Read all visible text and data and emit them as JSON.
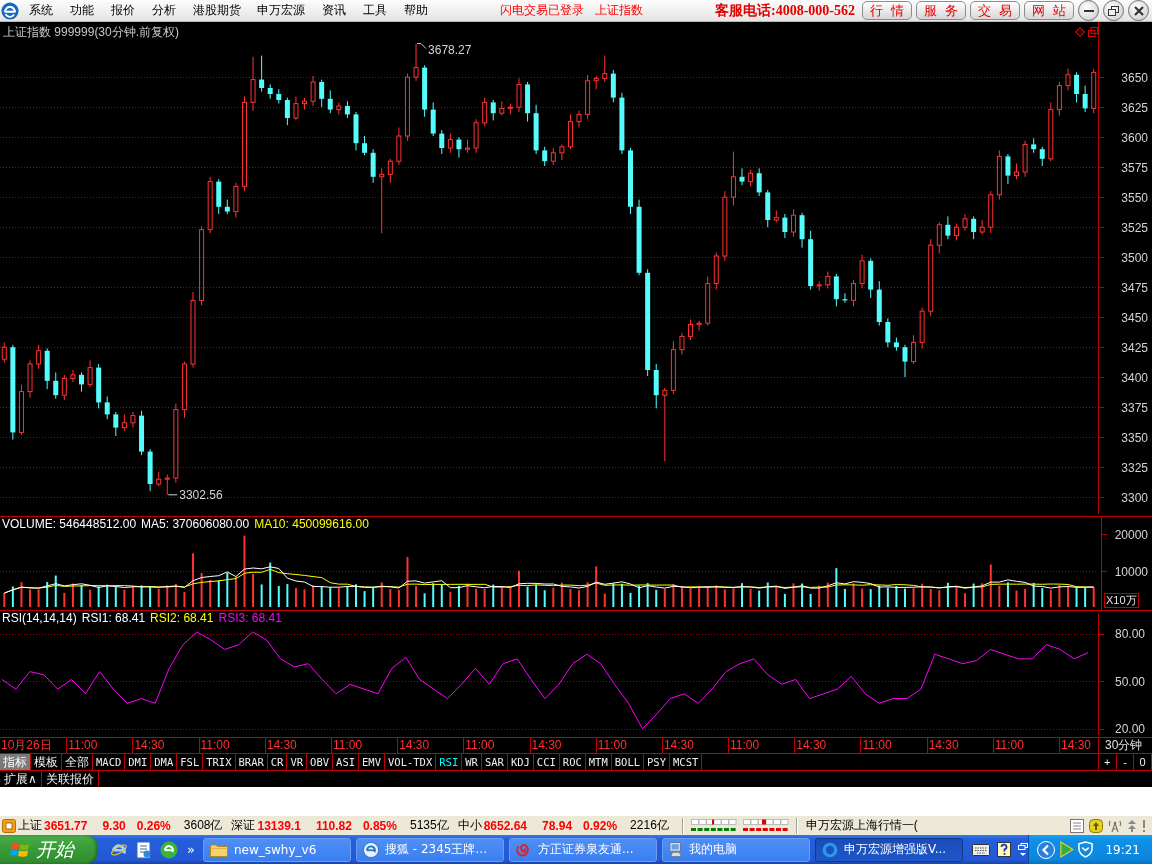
{
  "menu_bar": {
    "items": [
      "系统",
      "功能",
      "报价",
      "分析",
      "港股期货",
      "申万宏源",
      "资讯",
      "工具",
      "帮助"
    ],
    "notices": [
      "闪电交易已登录",
      "上证指数"
    ],
    "hotline": "客服电话:4008-000-562",
    "buttons": [
      "行情",
      "服务",
      "交易",
      "网站"
    ]
  },
  "price_chart": {
    "title": "上证指数 999999(30分钟.前复权)",
    "high_label": "3678.27",
    "low_label": "3302.56",
    "chart_data": {
      "type": "candlestick",
      "ylim": [
        3286,
        3696
      ],
      "yticks": [
        3650,
        3625,
        3600,
        3575,
        3550,
        3525,
        3500,
        3475,
        3450,
        3425,
        3400,
        3375,
        3350,
        3325,
        3300
      ],
      "grid": true,
      "ohlc": [
        [
          3415,
          3429,
          3412,
          3425
        ],
        [
          3425,
          3427,
          3348,
          3354
        ],
        [
          3354,
          3394,
          3352,
          3388
        ],
        [
          3388,
          3414,
          3383,
          3411
        ],
        [
          3411,
          3427,
          3407,
          3422
        ],
        [
          3422,
          3424,
          3390,
          3397
        ],
        [
          3397,
          3404,
          3382,
          3385
        ],
        [
          3385,
          3402,
          3381,
          3399
        ],
        [
          3399,
          3406,
          3396,
          3402
        ],
        [
          3402,
          3404,
          3388,
          3394
        ],
        [
          3394,
          3414,
          3392,
          3408
        ],
        [
          3408,
          3411,
          3374,
          3379
        ],
        [
          3379,
          3384,
          3365,
          3369
        ],
        [
          3369,
          3371,
          3351,
          3358
        ],
        [
          3358,
          3369,
          3355,
          3362
        ],
        [
          3362,
          3371,
          3358,
          3368
        ],
        [
          3368,
          3372,
          3335,
          3338
        ],
        [
          3338,
          3340,
          3305,
          3311
        ],
        [
          3311,
          3321,
          3309,
          3315
        ],
        [
          3315,
          3319,
          3302,
          3316
        ],
        [
          3316,
          3378,
          3312,
          3373
        ],
        [
          3373,
          3413,
          3366,
          3411
        ],
        [
          3411,
          3471,
          3408,
          3464
        ],
        [
          3464,
          3526,
          3460,
          3523
        ],
        [
          3523,
          3567,
          3520,
          3563
        ],
        [
          3563,
          3565,
          3536,
          3542
        ],
        [
          3542,
          3548,
          3536,
          3538
        ],
        [
          3538,
          3562,
          3533,
          3559
        ],
        [
          3559,
          3634,
          3555,
          3629
        ],
        [
          3629,
          3667,
          3622,
          3648
        ],
        [
          3648,
          3668,
          3638,
          3641
        ],
        [
          3641,
          3644,
          3632,
          3636
        ],
        [
          3636,
          3640,
          3628,
          3631
        ],
        [
          3631,
          3633,
          3610,
          3616
        ],
        [
          3616,
          3634,
          3614,
          3628
        ],
        [
          3628,
          3633,
          3623,
          3630
        ],
        [
          3630,
          3651,
          3626,
          3646
        ],
        [
          3646,
          3648,
          3625,
          3632
        ],
        [
          3632,
          3639,
          3620,
          3623
        ],
        [
          3623,
          3629,
          3619,
          3626
        ],
        [
          3626,
          3630,
          3616,
          3619
        ],
        [
          3619,
          3621,
          3589,
          3595
        ],
        [
          3595,
          3601,
          3585,
          3587
        ],
        [
          3587,
          3590,
          3562,
          3567
        ],
        [
          3567,
          3574,
          3520,
          3569
        ],
        [
          3569,
          3582,
          3562,
          3580
        ],
        [
          3580,
          3608,
          3577,
          3601
        ],
        [
          3601,
          3653,
          3597,
          3650
        ],
        [
          3650,
          3678,
          3647,
          3658
        ],
        [
          3658,
          3660,
          3617,
          3623
        ],
        [
          3623,
          3629,
          3601,
          3603
        ],
        [
          3603,
          3606,
          3586,
          3591
        ],
        [
          3591,
          3603,
          3587,
          3598
        ],
        [
          3598,
          3600,
          3583,
          3590
        ],
        [
          3590,
          3598,
          3587,
          3591
        ],
        [
          3591,
          3615,
          3587,
          3612
        ],
        [
          3612,
          3633,
          3609,
          3629
        ],
        [
          3629,
          3631,
          3614,
          3620
        ],
        [
          3620,
          3630,
          3618,
          3624
        ],
        [
          3624,
          3628,
          3619,
          3625
        ],
        [
          3625,
          3649,
          3621,
          3644
        ],
        [
          3644,
          3646,
          3613,
          3620
        ],
        [
          3620,
          3627,
          3586,
          3589
        ],
        [
          3589,
          3592,
          3576,
          3580
        ],
        [
          3580,
          3591,
          3577,
          3587
        ],
        [
          3587,
          3594,
          3581,
          3592
        ],
        [
          3592,
          3619,
          3590,
          3613
        ],
        [
          3613,
          3622,
          3608,
          3619
        ],
        [
          3619,
          3652,
          3615,
          3647
        ],
        [
          3647,
          3651,
          3640,
          3649
        ],
        [
          3649,
          3668,
          3646,
          3653
        ],
        [
          3653,
          3656,
          3629,
          3633
        ],
        [
          3633,
          3637,
          3586,
          3589
        ],
        [
          3589,
          3591,
          3536,
          3542
        ],
        [
          3542,
          3548,
          3485,
          3487
        ],
        [
          3487,
          3490,
          3401,
          3406
        ],
        [
          3406,
          3411,
          3374,
          3385
        ],
        [
          3385,
          3391,
          3330,
          3389
        ],
        [
          3389,
          3430,
          3386,
          3423
        ],
        [
          3423,
          3437,
          3419,
          3434
        ],
        [
          3434,
          3448,
          3431,
          3444
        ],
        [
          3444,
          3447,
          3439,
          3445
        ],
        [
          3445,
          3484,
          3443,
          3478
        ],
        [
          3478,
          3504,
          3473,
          3501
        ],
        [
          3501,
          3555,
          3497,
          3550
        ],
        [
          3550,
          3588,
          3543,
          3567
        ],
        [
          3567,
          3574,
          3560,
          3563
        ],
        [
          3563,
          3573,
          3559,
          3570
        ],
        [
          3570,
          3574,
          3551,
          3554
        ],
        [
          3554,
          3556,
          3525,
          3531
        ],
        [
          3531,
          3539,
          3529,
          3533
        ],
        [
          3533,
          3536,
          3516,
          3521
        ],
        [
          3521,
          3540,
          3517,
          3535
        ],
        [
          3535,
          3537,
          3508,
          3515
        ],
        [
          3515,
          3522,
          3473,
          3476
        ],
        [
          3476,
          3480,
          3472,
          3477
        ],
        [
          3477,
          3488,
          3474,
          3484
        ],
        [
          3484,
          3486,
          3459,
          3465
        ],
        [
          3465,
          3470,
          3462,
          3464
        ],
        [
          3464,
          3481,
          3459,
          3478
        ],
        [
          3478,
          3502,
          3474,
          3497
        ],
        [
          3497,
          3499,
          3466,
          3473
        ],
        [
          3473,
          3480,
          3443,
          3446
        ],
        [
          3446,
          3449,
          3425,
          3429
        ],
        [
          3429,
          3433,
          3422,
          3425
        ],
        [
          3425,
          3427,
          3400,
          3413
        ],
        [
          3413,
          3435,
          3411,
          3429
        ],
        [
          3429,
          3458,
          3424,
          3455
        ],
        [
          3455,
          3515,
          3451,
          3510
        ],
        [
          3510,
          3529,
          3503,
          3527
        ],
        [
          3527,
          3534,
          3515,
          3518
        ],
        [
          3518,
          3528,
          3514,
          3525
        ],
        [
          3525,
          3536,
          3522,
          3532
        ],
        [
          3532,
          3534,
          3515,
          3521
        ],
        [
          3521,
          3531,
          3519,
          3525
        ],
        [
          3525,
          3555,
          3520,
          3552
        ],
        [
          3552,
          3589,
          3548,
          3584
        ],
        [
          3584,
          3586,
          3561,
          3568
        ],
        [
          3568,
          3578,
          3565,
          3571
        ],
        [
          3571,
          3597,
          3567,
          3594
        ],
        [
          3594,
          3599,
          3587,
          3590
        ],
        [
          3590,
          3592,
          3576,
          3582
        ],
        [
          3582,
          3629,
          3580,
          3623
        ],
        [
          3623,
          3646,
          3618,
          3643
        ],
        [
          3643,
          3657,
          3639,
          3652
        ],
        [
          3652,
          3654,
          3629,
          3636
        ],
        [
          3636,
          3643,
          3621,
          3624
        ],
        [
          3624,
          3657,
          3620,
          3654
        ]
      ]
    }
  },
  "volume_chart": {
    "legend": [
      {
        "text": "VOLUME: 546448512.00",
        "color": "#ffffff"
      },
      {
        "text": "MA5: 370606080.00",
        "color": "#ffffff"
      },
      {
        "text": "MA10: 450099616.00",
        "color": "#ffff00"
      }
    ],
    "axis_labels": [
      "20000",
      "10000"
    ],
    "unit": "X10万"
  },
  "rsi_chart": {
    "legend": [
      {
        "text": "RSI(14,14,14)",
        "color": "#ffffff"
      },
      {
        "text": "RSI1: 68.41",
        "color": "#ffffff"
      },
      {
        "text": "RSI2: 68.41",
        "color": "#ffff00"
      },
      {
        "text": "RSI3: 68.41",
        "color": "#ff00ff"
      }
    ],
    "chart_data": {
      "type": "line",
      "ylim": [
        16,
        93
      ],
      "yticks": [
        {
          "value": 80,
          "label": "80.00"
        },
        {
          "value": 50,
          "label": "50.00"
        },
        {
          "value": 20,
          "label": "20.00"
        }
      ],
      "grid": true,
      "series": [
        {
          "color": "#ff00ff",
          "values": [
            51,
            45,
            56,
            54,
            45,
            51,
            42,
            56,
            45,
            36,
            39,
            36,
            58,
            73,
            81,
            76,
            70,
            73,
            81,
            76,
            64,
            59,
            61,
            51,
            42,
            48,
            45,
            42,
            58,
            65,
            51,
            45,
            39,
            48,
            58,
            48,
            61,
            64,
            51,
            39,
            48,
            61,
            67,
            61,
            48,
            36,
            20,
            29,
            39,
            42,
            36,
            45,
            56,
            61,
            64,
            54,
            48,
            51,
            39,
            42,
            45,
            53,
            42,
            36,
            39,
            39,
            45,
            67,
            64,
            61,
            63,
            70,
            67,
            64,
            64,
            73,
            70,
            64,
            68
          ]
        }
      ]
    }
  },
  "time_axis": {
    "labels": [
      "10月26日",
      "11:00",
      "14:30",
      "11:00",
      "14:30",
      "11:00",
      "14:30",
      "11:00",
      "14:30",
      "11:00",
      "14:30",
      "11:00",
      "14:30",
      "11:00",
      "14:30",
      "11:00",
      "14:30"
    ],
    "period": "30分钟"
  },
  "panel_tabs": [
    {
      "label": "指标",
      "selected": true
    },
    {
      "label": "模板",
      "selected": false
    }
  ],
  "indicator_tabs": [
    {
      "label": "全部",
      "selected": false
    },
    {
      "label": "MACD",
      "selected": false
    },
    {
      "label": "DMI",
      "selected": false
    },
    {
      "label": "DMA",
      "selected": false
    },
    {
      "label": "FSL",
      "selected": false
    },
    {
      "label": "TRIX",
      "selected": false
    },
    {
      "label": "BRAR",
      "selected": false
    },
    {
      "label": "CR",
      "selected": false
    },
    {
      "label": "VR",
      "selected": false
    },
    {
      "label": "OBV",
      "selected": false
    },
    {
      "label": "ASI",
      "selected": false
    },
    {
      "label": "EMV",
      "selected": false
    },
    {
      "label": "VOL-TDX",
      "selected": false
    },
    {
      "label": "RSI",
      "selected": true
    },
    {
      "label": "WR",
      "selected": false
    },
    {
      "label": "SAR",
      "selected": false
    },
    {
      "label": "KDJ",
      "selected": false
    },
    {
      "label": "CCI",
      "selected": false
    },
    {
      "label": "ROC",
      "selected": false
    },
    {
      "label": "MTM",
      "selected": false
    },
    {
      "label": "BOLL",
      "selected": false
    },
    {
      "label": "PSY",
      "selected": false
    },
    {
      "label": "MCST",
      "selected": false
    }
  ],
  "zoom_buttons": [
    "+",
    "-",
    "0"
  ],
  "extra_tabs": [
    "扩展∧",
    "关联报价"
  ],
  "status_bar": {
    "quotes": [
      {
        "name": "上证",
        "value": "3651.77",
        "change": "9.30",
        "percent": "0.26%",
        "turnover": "3608亿",
        "rising": true
      },
      {
        "name": "深证",
        "value": "13139.1",
        "change": "110.82",
        "percent": "0.85%",
        "turnover": "5135亿",
        "rising": true
      },
      {
        "name": "中小",
        "value": "8652.64",
        "change": "78.94",
        "percent": "0.92%",
        "turnover": "2216亿",
        "rising": true
      }
    ],
    "feed": "申万宏源上海行情一("
  },
  "taskbar": {
    "start": "开始",
    "more": "»",
    "tasks": [
      {
        "label": "new_swhy_v6",
        "kind": "folder",
        "selected": false
      },
      {
        "label": "搜狐 - 2345王牌...",
        "kind": "browser",
        "selected": false
      },
      {
        "label": "方正证券泉友通...",
        "kind": "swirl",
        "selected": false
      },
      {
        "label": "我的电脑",
        "kind": "computer",
        "selected": false
      },
      {
        "label": "申万宏源增强版V...",
        "kind": "ring",
        "selected": true
      }
    ],
    "clock": "19:21"
  }
}
